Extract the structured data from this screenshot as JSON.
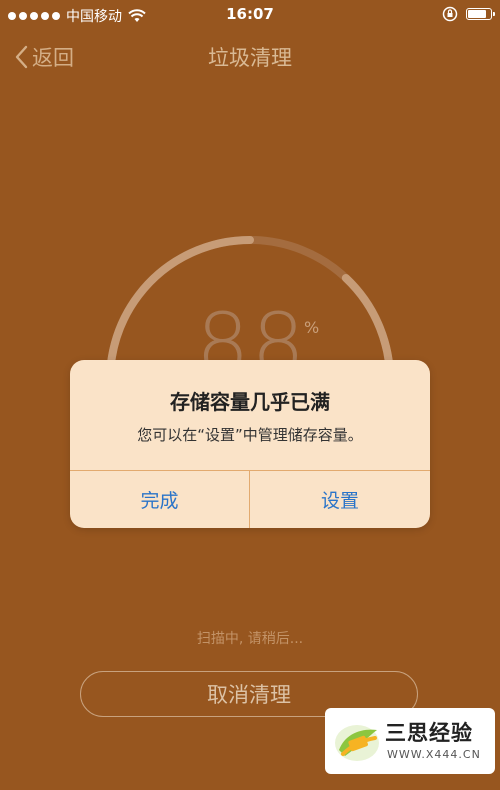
{
  "status_bar": {
    "carrier": "中国移动",
    "time": "16:07",
    "icons": [
      "signal-dots-icon",
      "wifi-icon",
      "orientation-lock-icon",
      "battery-icon"
    ]
  },
  "nav": {
    "back_label": "返回",
    "title": "垃圾清理"
  },
  "gauge": {
    "value": "88",
    "unit": "%",
    "progress": 0.88
  },
  "dialog": {
    "title": "存储容量几乎已满",
    "message": "您可以在“设置”中管理储存容量。",
    "left_button": "完成",
    "right_button": "设置"
  },
  "scan_status": "扫描中, 请稍后...",
  "cancel_button": "取消清理",
  "watermark": {
    "title": "三思经验",
    "url": "WWW.X444.CN"
  },
  "colors": {
    "background": "#97561f",
    "dialog_background": "#fae3c8",
    "dialog_button_text": "#2a74c9"
  }
}
